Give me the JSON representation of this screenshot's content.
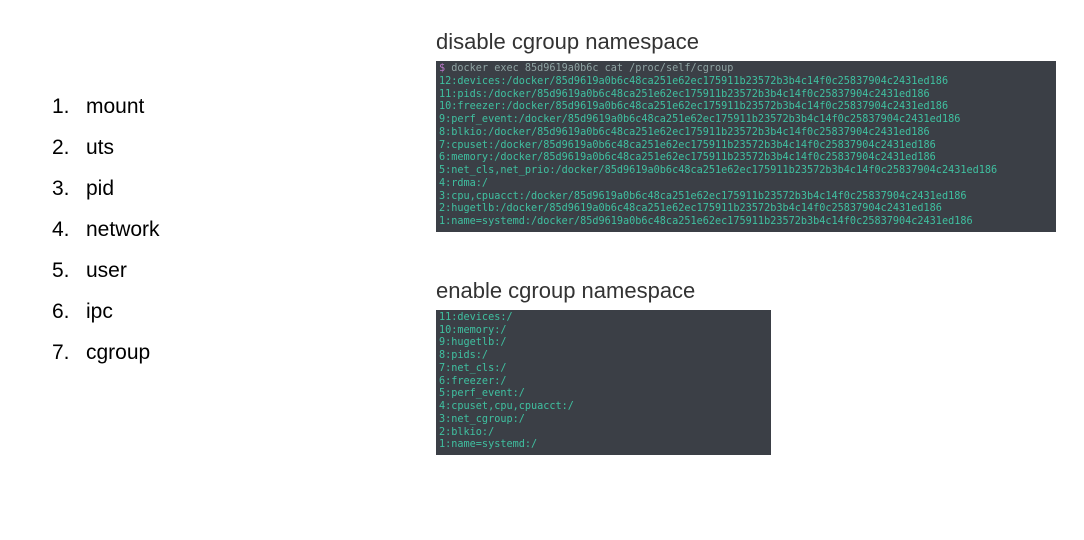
{
  "list": {
    "items": [
      {
        "num": "1.",
        "label": "mount"
      },
      {
        "num": "2.",
        "label": "uts"
      },
      {
        "num": "3.",
        "label": "pid"
      },
      {
        "num": "4.",
        "label": "network"
      },
      {
        "num": "5.",
        "label": "user"
      },
      {
        "num": "6.",
        "label": "ipc"
      },
      {
        "num": "7.",
        "label": "cgroup"
      }
    ]
  },
  "disable": {
    "title": "disable cgroup namespace",
    "prompt": "$",
    "command": " docker exec 85d9619a0b6c cat /proc/self/cgroup",
    "lines": [
      "12:devices:/docker/85d9619a0b6c48ca251e62ec175911b23572b3b4c14f0c25837904c2431ed186",
      "11:pids:/docker/85d9619a0b6c48ca251e62ec175911b23572b3b4c14f0c25837904c2431ed186",
      "10:freezer:/docker/85d9619a0b6c48ca251e62ec175911b23572b3b4c14f0c25837904c2431ed186",
      "9:perf_event:/docker/85d9619a0b6c48ca251e62ec175911b23572b3b4c14f0c25837904c2431ed186",
      "8:blkio:/docker/85d9619a0b6c48ca251e62ec175911b23572b3b4c14f0c25837904c2431ed186",
      "7:cpuset:/docker/85d9619a0b6c48ca251e62ec175911b23572b3b4c14f0c25837904c2431ed186",
      "6:memory:/docker/85d9619a0b6c48ca251e62ec175911b23572b3b4c14f0c25837904c2431ed186",
      "5:net_cls,net_prio:/docker/85d9619a0b6c48ca251e62ec175911b23572b3b4c14f0c25837904c2431ed186",
      "4:rdma:/",
      "3:cpu,cpuacct:/docker/85d9619a0b6c48ca251e62ec175911b23572b3b4c14f0c25837904c2431ed186",
      "2:hugetlb:/docker/85d9619a0b6c48ca251e62ec175911b23572b3b4c14f0c25837904c2431ed186",
      "1:name=systemd:/docker/85d9619a0b6c48ca251e62ec175911b23572b3b4c14f0c25837904c2431ed186"
    ]
  },
  "enable": {
    "title": "enable cgroup namespace",
    "lines": [
      "11:devices:/",
      "10:memory:/",
      "9:hugetlb:/",
      "8:pids:/",
      "7:net_cls:/",
      "6:freezer:/",
      "5:perf_event:/",
      "4:cpuset,cpu,cpuacct:/",
      "3:net_cgroup:/",
      "2:blkio:/",
      "1:name=systemd:/"
    ]
  }
}
